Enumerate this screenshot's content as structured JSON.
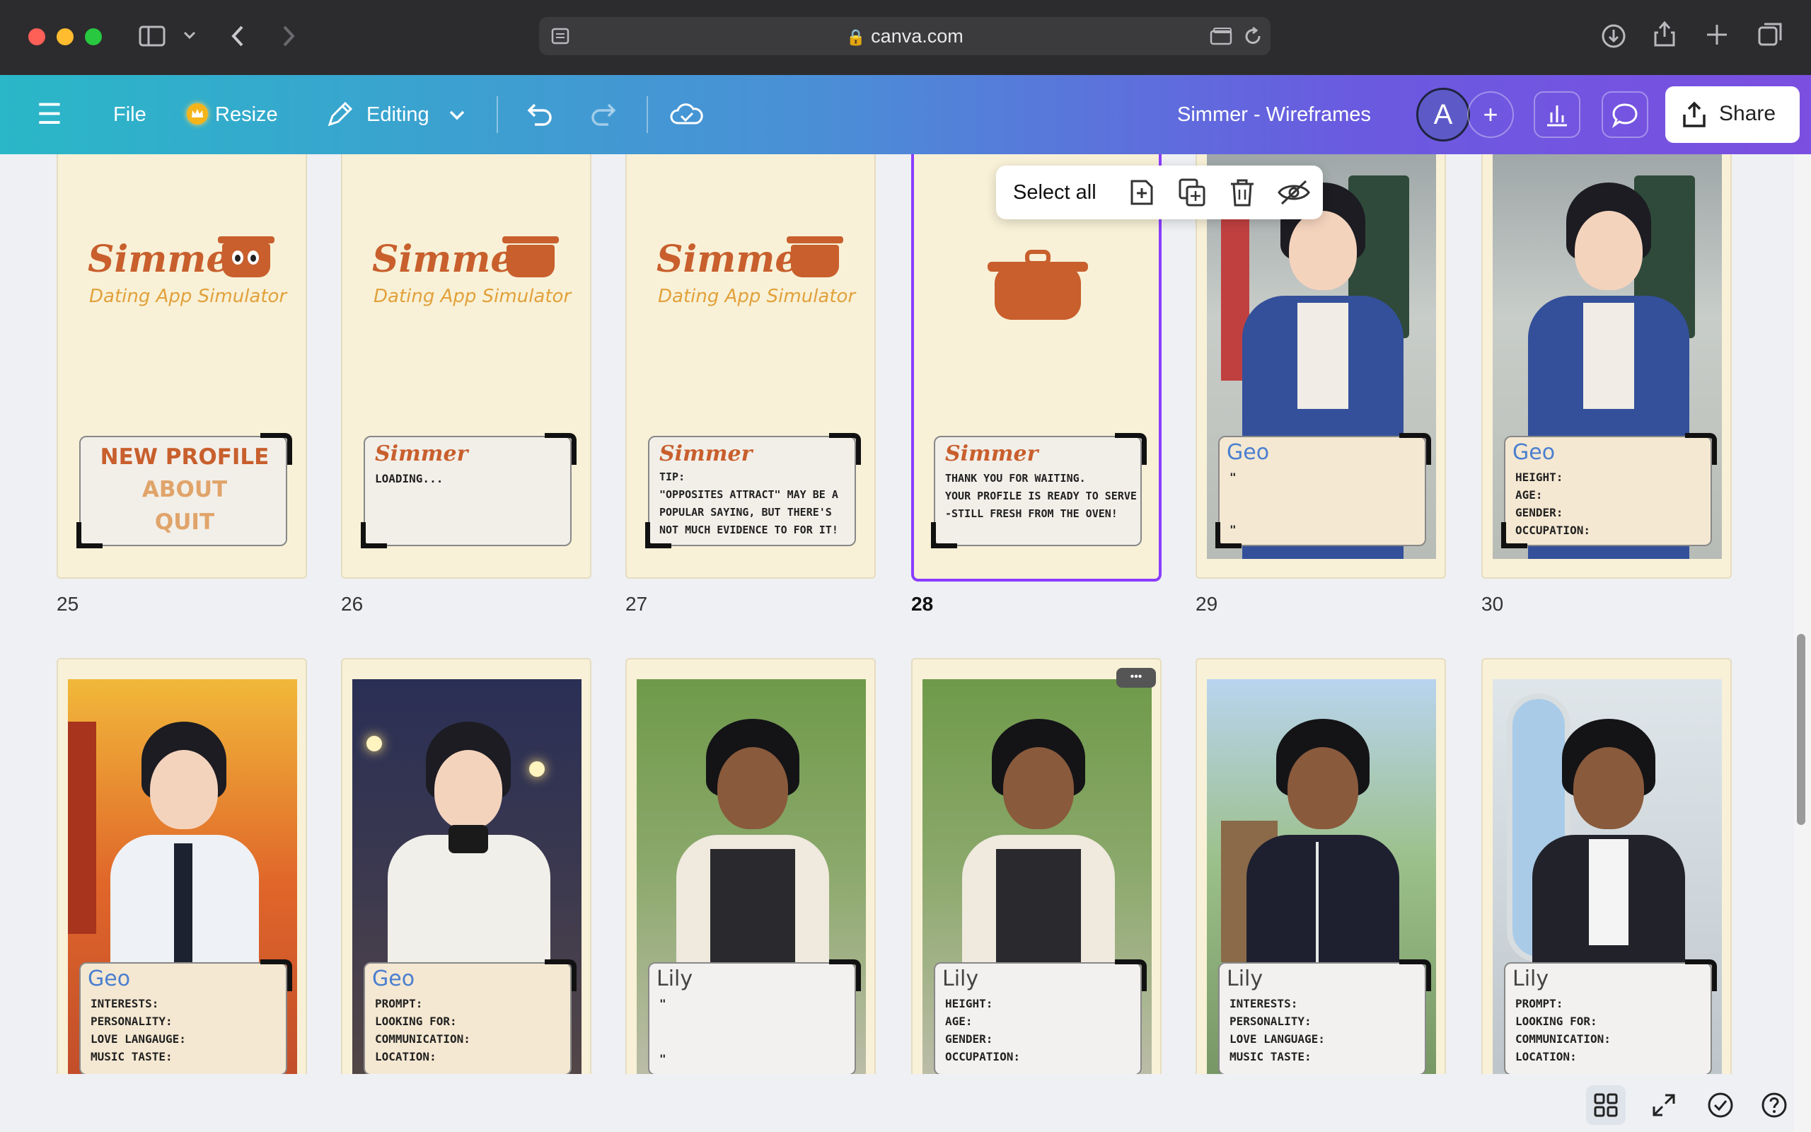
{
  "browser": {
    "url": "canva.com",
    "icons": [
      "sidebar-icon",
      "chevron-down-icon",
      "back-icon",
      "forward-icon",
      "reader-icon",
      "lock-icon",
      "tab-icon",
      "reload-icon",
      "download-icon",
      "share-icon",
      "new-tab-icon",
      "tabs-overview-icon"
    ]
  },
  "toolbar": {
    "menu_icon": "☰",
    "file_label": "File",
    "resize_label": "Resize",
    "editing_label": "Editing",
    "doc_title": "Simmer - Wireframes",
    "avatar_letter": "A",
    "share_label": "Share"
  },
  "page_tools": {
    "select_all": "Select all"
  },
  "row1": [
    {
      "num": "25"
    },
    {
      "num": "26"
    },
    {
      "num": "27"
    },
    {
      "num": "28"
    },
    {
      "num": "29"
    },
    {
      "num": "30"
    }
  ],
  "logo": {
    "word": "Simmer",
    "subtitle": "Dating App Simulator"
  },
  "menu": {
    "new_profile": "NEW PROFILE",
    "about": "ABOUT",
    "quit": "QUIT"
  },
  "dialogs": {
    "p26_name": "Simmer",
    "p26_body": "LOADING...",
    "p27_name": "Simmer",
    "p27_line1": "TIP:",
    "p27_line2": "\"OPPOSITES ATTRACT\" MAY BE A",
    "p27_line3": "POPULAR SAYING, BUT THERE'S",
    "p27_line4": "NOT MUCH EVIDENCE TO FOR IT!",
    "p28_name": "Simmer",
    "p28_line1": "THANK YOU FOR WAITING.",
    "p28_line2": "YOUR PROFILE IS READY TO SERVE",
    "p28_line3": "-STILL FRESH FROM THE OVEN!",
    "p29_name": "Geo",
    "p29_open": "\"",
    "p29_close": "\"",
    "p30_name": "Geo",
    "p30_l1": "HEIGHT:",
    "p30_l2": "AGE:",
    "p30_l3": "GENDER:",
    "p30_l4": "OCCUPATION:",
    "r2_1_name": "Geo",
    "r2_1_l1": "INTERESTS:",
    "r2_1_l2": "PERSONALITY:",
    "r2_1_l3": "LOVE LANGAUGE:",
    "r2_1_l4": "MUSIC TASTE:",
    "r2_2_name": "Geo",
    "r2_2_l1": "PROMPT:",
    "r2_2_l2": "LOOKING FOR:",
    "r2_2_l3": "COMMUNICATION:",
    "r2_2_l4": "LOCATION:",
    "r2_3_name": "Lily",
    "r2_3_open": "\"",
    "r2_3_close": "\"",
    "r2_4_name": "Lily",
    "r2_4_l1": "HEIGHT:",
    "r2_4_l2": "AGE:",
    "r2_4_l3": "GENDER:",
    "r2_4_l4": "OCCUPATION:",
    "r2_5_name": "Lily",
    "r2_5_l1": "INTERESTS:",
    "r2_5_l2": "PERSONALITY:",
    "r2_5_l3": "LOVE LANGUAGE:",
    "r2_5_l4": "MUSIC TASTE:",
    "r2_6_name": "Lily",
    "r2_6_l1": "PROMPT:",
    "r2_6_l2": "LOOKING FOR:",
    "r2_6_l3": "COMMUNICATION:",
    "r2_6_l4": "LOCATION:"
  },
  "more_label": "•••",
  "colors": {
    "accent": "#8b3dff",
    "brand_orange": "#c85f2d",
    "page_bg": "#f8f1d7",
    "name_blue": "#4a7fd0"
  }
}
